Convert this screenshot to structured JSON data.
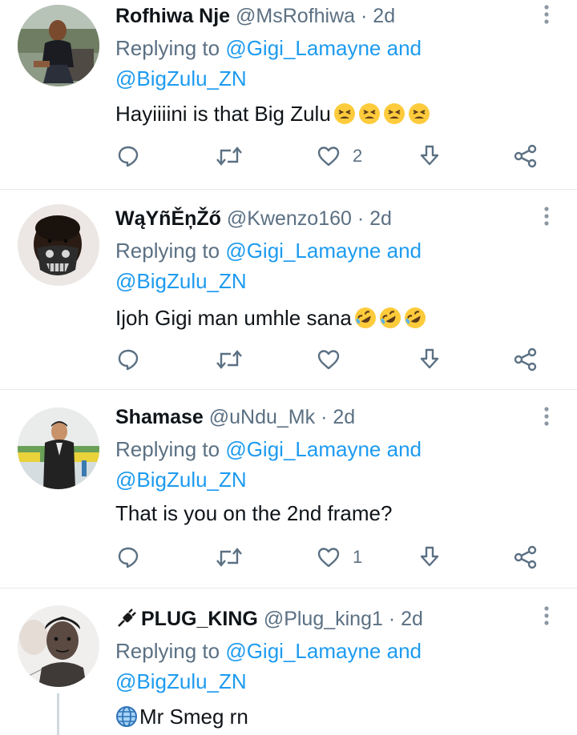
{
  "colors": {
    "text": "#0f1419",
    "muted": "#5b7083",
    "accent": "#1d9bf0",
    "divider": "#e6e9ec"
  },
  "replies": [
    {
      "display_name": "Rofhiwa Nje",
      "handle": "@MsRofhiwa",
      "separator": "·",
      "time": "2d",
      "replying_prefix": "Replying to",
      "mention_1": "@Gigi_Lamayne",
      "conjunction": "and",
      "mention_2": "@BigZulu_ZN",
      "text": "Hayiiiini is that Big Zulu",
      "emoji": [
        "tired-face",
        "tired-face",
        "tired-face",
        "tired-face"
      ],
      "like_count": "2",
      "icons": [
        "reply-icon",
        "retweet-icon",
        "like-icon",
        "download-icon",
        "share-icon"
      ]
    },
    {
      "display_name": "WąYñĚņŽő",
      "handle": "@Kwenzo160",
      "separator": "·",
      "time": "2d",
      "replying_prefix": "Replying to",
      "mention_1": "@Gigi_Lamayne",
      "conjunction": "and",
      "mention_2": "@BigZulu_ZN",
      "text": "Ijoh Gigi man umhle sana",
      "emoji": [
        "rolling-laughing",
        "rolling-laughing",
        "rolling-laughing"
      ],
      "like_count": "",
      "icons": [
        "reply-icon",
        "retweet-icon",
        "like-icon",
        "download-icon",
        "share-icon"
      ]
    },
    {
      "display_name": "Shamase",
      "handle": "@uNdu_Mk",
      "separator": "·",
      "time": "2d",
      "replying_prefix": "Replying to",
      "mention_1": "@Gigi_Lamayne",
      "conjunction": "and",
      "mention_2": "@BigZulu_ZN",
      "text": "That is you on the 2nd frame?",
      "emoji": [],
      "like_count": "1",
      "icons": [
        "reply-icon",
        "retweet-icon",
        "like-icon",
        "download-icon",
        "share-icon"
      ]
    },
    {
      "display_name": "PLUG_KING",
      "name_emoji": "plug",
      "handle": "@Plug_king1",
      "separator": "·",
      "time": "2d",
      "replying_prefix": "Replying to",
      "mention_1": "@Gigi_Lamayne",
      "conjunction": "and",
      "mention_2": "@BigZulu_ZN",
      "text": "Mr Smeg rn",
      "text_emoji": "globe-with-meridians"
    }
  ]
}
